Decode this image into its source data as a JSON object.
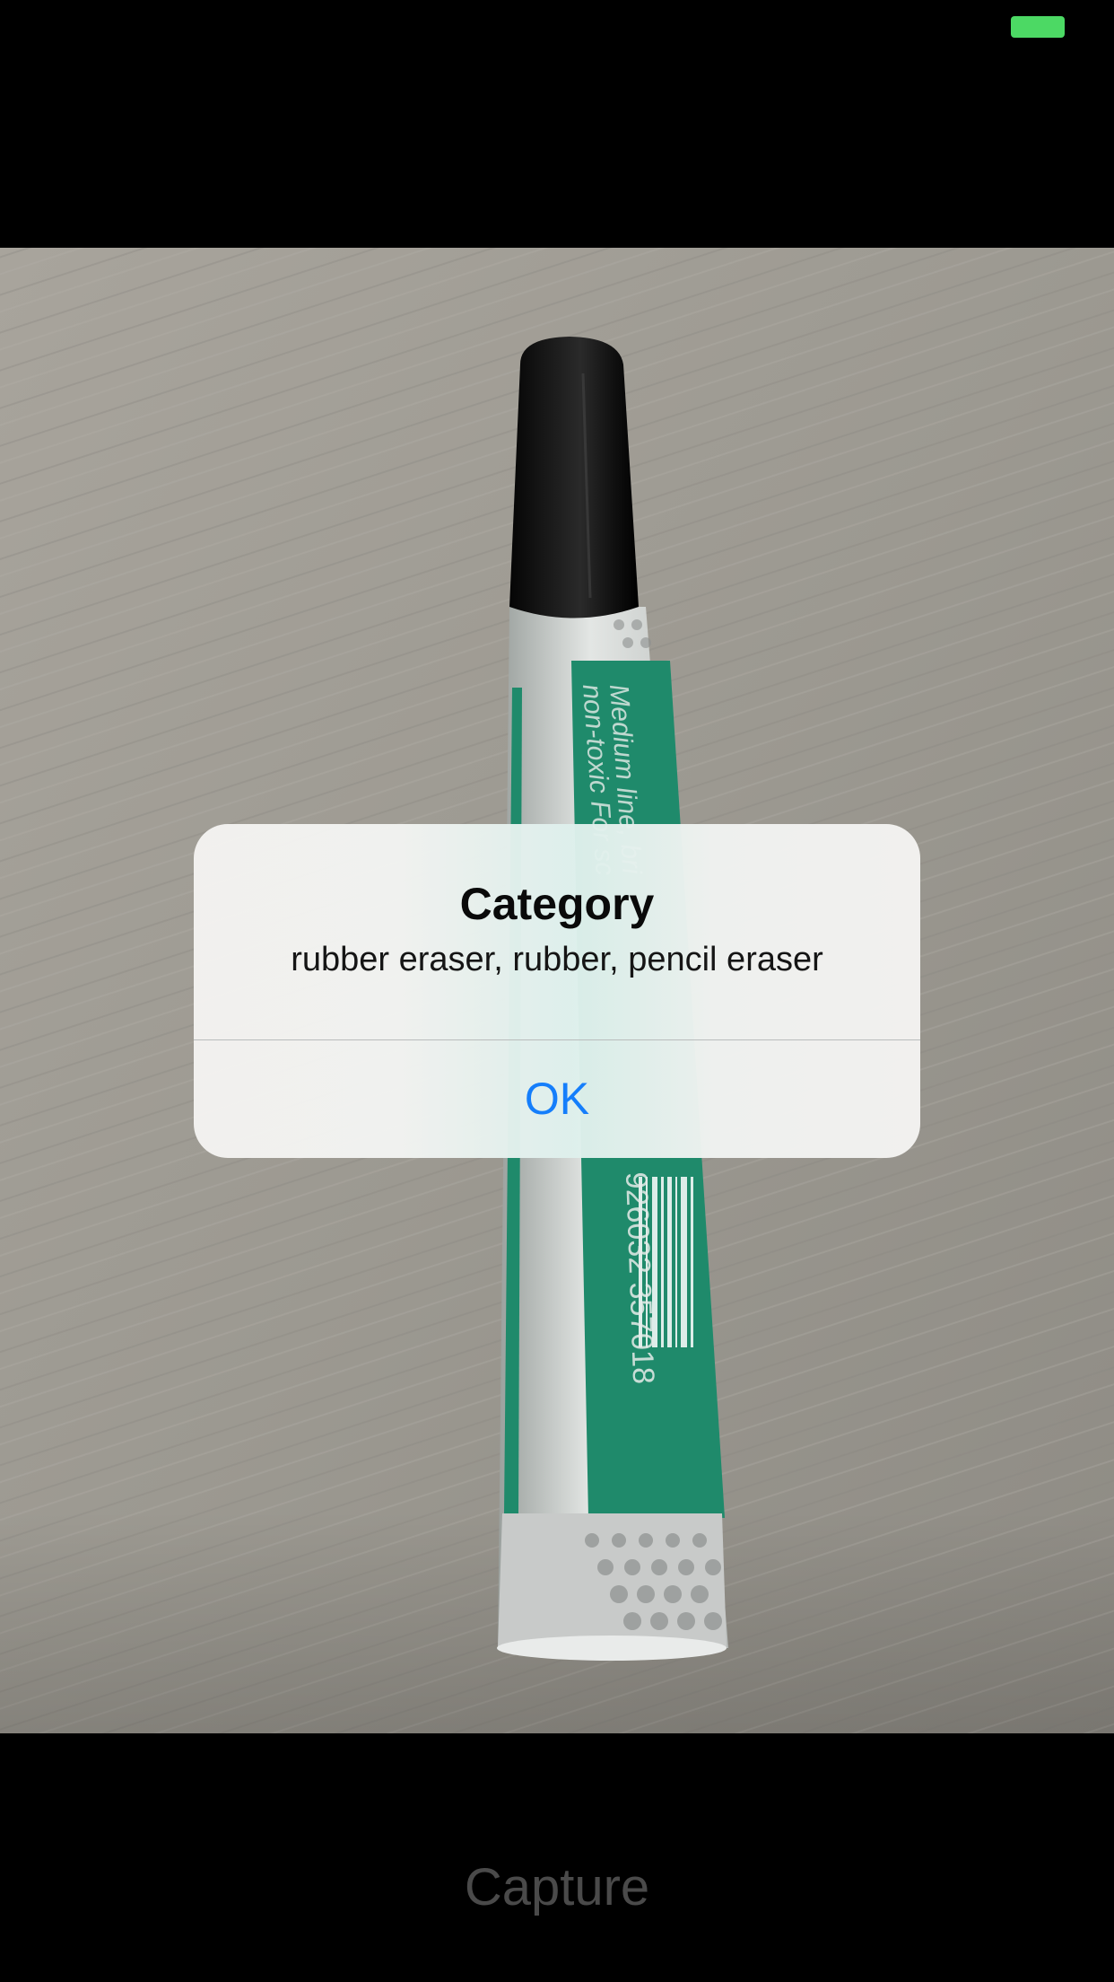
{
  "status_bar": {
    "battery_color": "#4cd964"
  },
  "camera": {
    "subject": "green and white marker with black cap on desk",
    "marker_print": {
      "line1": "Medium line, bri",
      "line2": "non-toxic For sc",
      "barcode_number": "926032 357018"
    }
  },
  "alert": {
    "title": "Category",
    "message": "rubber eraser, rubber, pencil eraser",
    "ok_label": "OK",
    "ok_color": "#157efb"
  },
  "bottom_bar": {
    "capture_label": "Capture"
  }
}
